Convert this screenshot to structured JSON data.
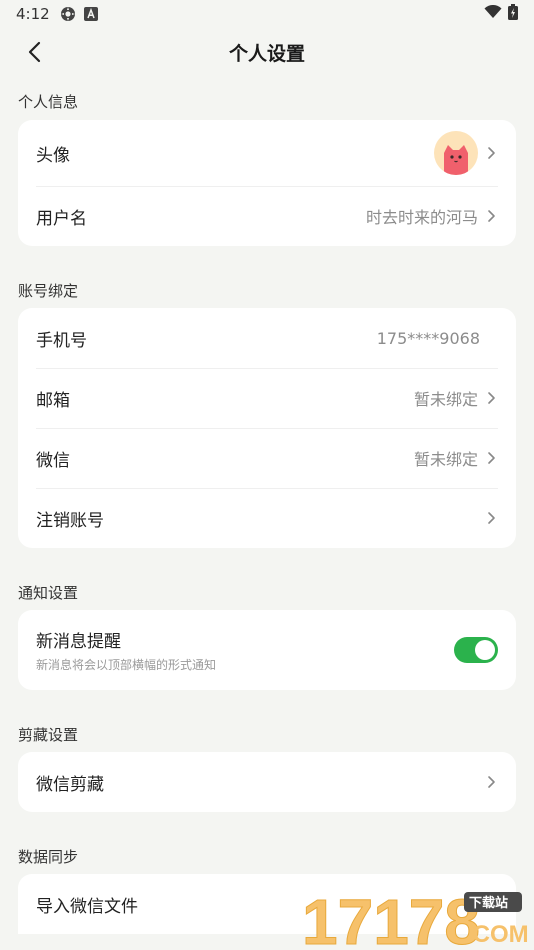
{
  "status_bar": {
    "time": "4:12",
    "icons": [
      "settings-gear-icon",
      "a-box-icon",
      "wifi-icon",
      "battery-icon"
    ]
  },
  "header": {
    "title": "个人设置",
    "back_icon": "chevron-left-icon"
  },
  "sections": {
    "personal": {
      "label": "个人信息",
      "avatar_label": "头像",
      "username_label": "用户名",
      "username_value": "时去时来的河马"
    },
    "account": {
      "label": "账号绑定",
      "phone_label": "手机号",
      "phone_value": "175****9068",
      "email_label": "邮箱",
      "email_value": "暂未绑定",
      "wechat_label": "微信",
      "wechat_value": "暂未绑定",
      "cancel_label": "注销账号"
    },
    "notify": {
      "label": "通知设置",
      "new_msg_label": "新消息提醒",
      "new_msg_sub": "新消息将会以顶部横幅的形式通知",
      "toggle_on": true
    },
    "clip": {
      "label": "剪藏设置",
      "wechat_clip_label": "微信剪藏"
    },
    "sync": {
      "label": "数据同步",
      "import_label": "导入微信文件"
    }
  },
  "watermark": {
    "number": "17178",
    "badge": "下载站",
    "suffix": ".COM"
  },
  "colors": {
    "background": "#f4f5f2",
    "card": "#ffffff",
    "toggle_on": "#2bb24c",
    "avatar_bg": "#fde3b9",
    "avatar_cat": "#f0606c",
    "watermark": "#f6c16b"
  }
}
